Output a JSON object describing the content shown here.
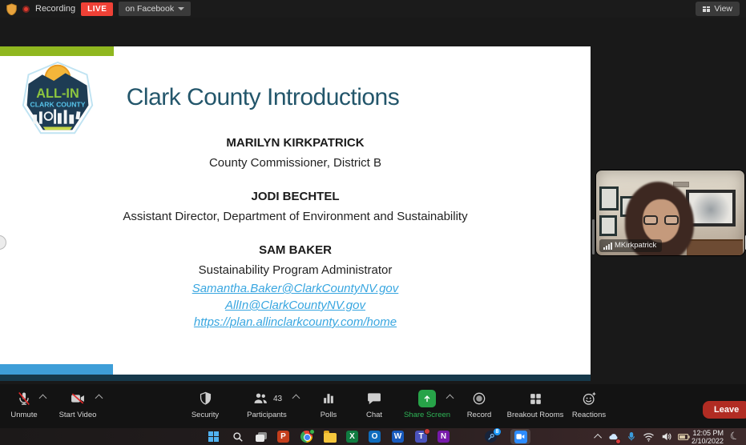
{
  "meeting": {
    "topbar": {
      "recording_label": "Recording",
      "live_label": "LIVE",
      "live_target": "on Facebook",
      "view_label": "View"
    },
    "slide": {
      "title": "Clark County Introductions",
      "logo": {
        "line1": "ALL-IN",
        "line2": "CLARK COUNTY"
      },
      "people": [
        {
          "name": "MARILYN KIRKPATRICK",
          "role": "County Commissioner, District B"
        },
        {
          "name": "JODI BECHTEL",
          "role": "Assistant Director, Department of Environment and Sustainability"
        },
        {
          "name": "SAM BAKER",
          "role": "Sustainability Program Administrator",
          "links": [
            "Samantha.Baker@ClarkCountyNV.gov",
            "AllIn@ClarkCountyNV.gov",
            "https://plan.allinclarkcounty.com/home"
          ]
        }
      ],
      "colors": {
        "title_color": "#23566b",
        "link_color": "#38a6e0",
        "accent_green": "#8fb71f",
        "accent_blue": "#3e9ed8",
        "accent_teal": "#16394b"
      }
    },
    "video": {
      "participant_label": "MKirkpatrick"
    },
    "toolbar": {
      "items": [
        {
          "label": "Unmute"
        },
        {
          "label": "Start Video"
        },
        {
          "label": "Security"
        },
        {
          "label": "Participants",
          "count": "43"
        },
        {
          "label": "Polls"
        },
        {
          "label": "Chat"
        },
        {
          "label": "Share Screen"
        },
        {
          "label": "Record"
        },
        {
          "label": "Breakout Rooms"
        },
        {
          "label": "Reactions"
        }
      ],
      "leave_label": "Leave",
      "share_green": "#27a348",
      "leave_red": "#b12c23"
    },
    "taskbar": {
      "clock_time": "12:05 PM",
      "clock_date": "2/10/2022",
      "steam_badge": "8",
      "word_letter": "W",
      "excel_letter": "X",
      "outlook_letter": "O",
      "powerpoint_letter": "P",
      "teams_letter": "T",
      "onenote_letter": "N"
    }
  }
}
